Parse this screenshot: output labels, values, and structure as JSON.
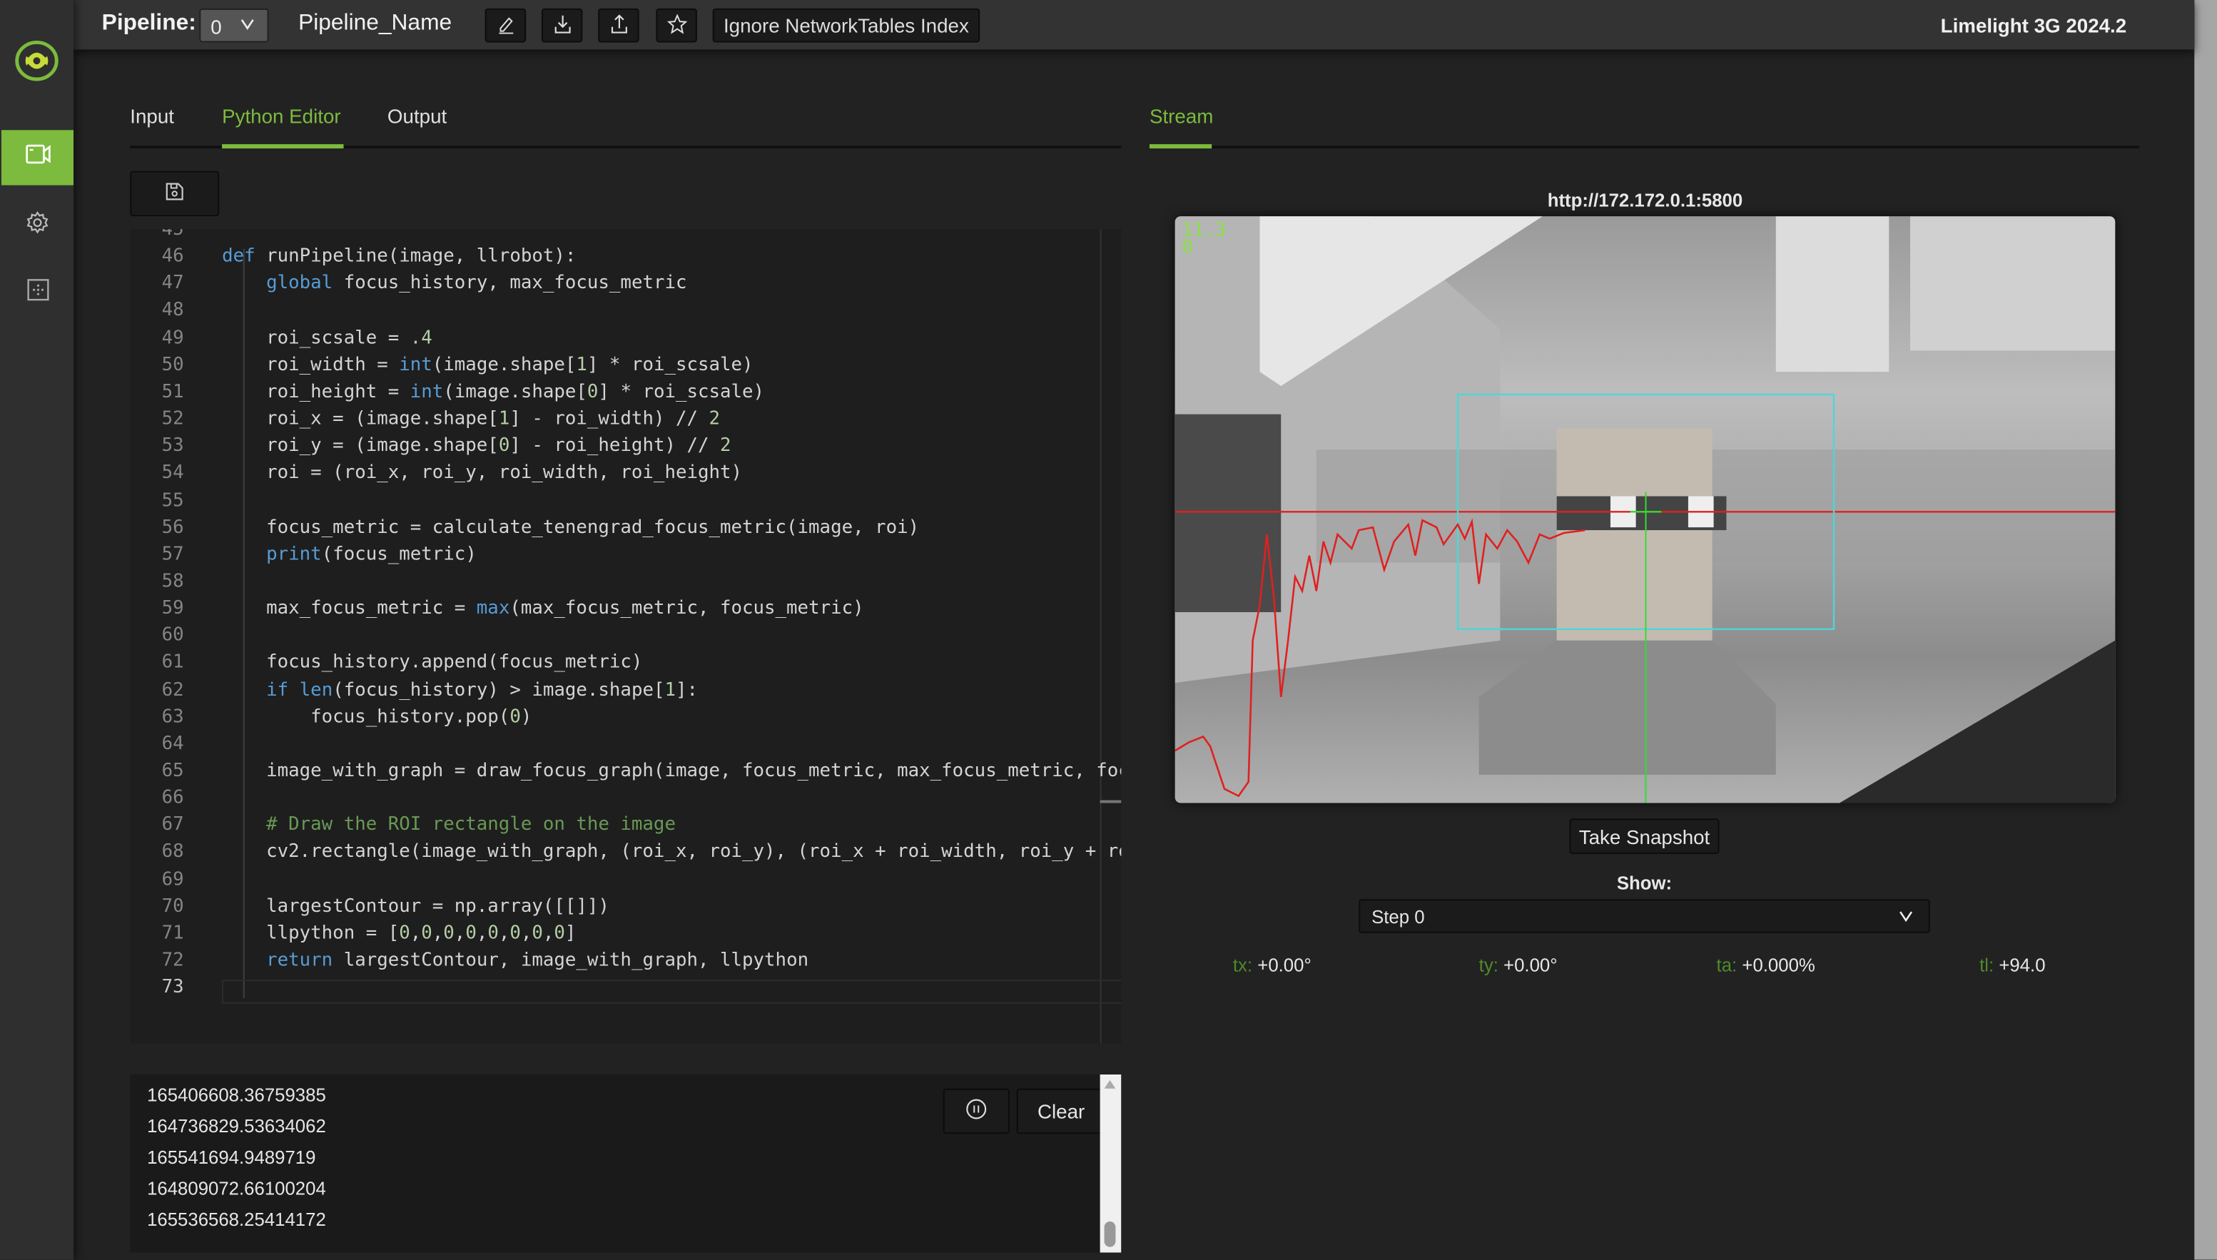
{
  "topbar": {
    "pipeline_label": "Pipeline:",
    "pipeline_index": "0",
    "pipeline_name": "Pipeline_Name",
    "edit_icon": "pencil-icon",
    "download_icon": "download-icon",
    "upload_icon": "upload-icon",
    "favorite_icon": "star-icon",
    "ignore_nt_label": "Ignore NetworkTables Index",
    "product": "Limelight 3G 2024.2"
  },
  "sidebar": {
    "items": [
      {
        "icon": "camera-icon",
        "active": true
      },
      {
        "icon": "gear-icon",
        "active": false
      },
      {
        "icon": "crosshair-grid-icon",
        "active": false
      }
    ]
  },
  "left_tabs": [
    "Input",
    "Python Editor",
    "Output"
  ],
  "active_left_tab": "Python Editor",
  "editor": {
    "save_icon": "floppy-disk-icon",
    "first_line_number": 45,
    "lines": [
      [],
      [
        [
          "def",
          "k"
        ],
        [
          " runPipeline(image, llrobot):",
          ""
        ]
      ],
      [
        [
          "    ",
          ""
        ],
        [
          "global",
          "k"
        ],
        [
          " focus_history, max_focus_metric",
          ""
        ]
      ],
      [],
      [
        [
          "    roi_scsale = ",
          ""
        ],
        [
          ".4",
          "n"
        ]
      ],
      [
        [
          "    roi_width = ",
          ""
        ],
        [
          "int",
          "k"
        ],
        [
          "(image.shape[",
          ""
        ],
        [
          "1",
          "n"
        ],
        [
          "] * roi_scsale)",
          ""
        ]
      ],
      [
        [
          "    roi_height = ",
          ""
        ],
        [
          "int",
          "k"
        ],
        [
          "(image.shape[",
          ""
        ],
        [
          "0",
          "n"
        ],
        [
          "] * roi_scsale)",
          ""
        ]
      ],
      [
        [
          "    roi_x = (image.shape[",
          ""
        ],
        [
          "1",
          "n"
        ],
        [
          "] - roi_width) // ",
          ""
        ],
        [
          "2",
          "n"
        ]
      ],
      [
        [
          "    roi_y = (image.shape[",
          ""
        ],
        [
          "0",
          "n"
        ],
        [
          "] - roi_height) // ",
          ""
        ],
        [
          "2",
          "n"
        ]
      ],
      [
        [
          "    roi = (roi_x, roi_y, roi_width, roi_height)",
          ""
        ]
      ],
      [],
      [
        [
          "    focus_metric = calculate_tenengrad_focus_metric(image, roi)",
          ""
        ]
      ],
      [
        [
          "    ",
          ""
        ],
        [
          "print",
          "k"
        ],
        [
          "(focus_metric)",
          ""
        ]
      ],
      [],
      [
        [
          "    max_focus_metric = ",
          ""
        ],
        [
          "max",
          "k"
        ],
        [
          "(max_focus_metric, focus_metric)",
          ""
        ]
      ],
      [],
      [
        [
          "    focus_history.append(focus_metric)",
          ""
        ]
      ],
      [
        [
          "    ",
          ""
        ],
        [
          "if",
          "k"
        ],
        [
          " ",
          ""
        ],
        [
          "len",
          "k"
        ],
        [
          "(focus_history) > image.shape[",
          ""
        ],
        [
          "1",
          "n"
        ],
        [
          "]:",
          ""
        ]
      ],
      [
        [
          "        focus_history.pop(",
          ""
        ],
        [
          "0",
          "n"
        ],
        [
          ")",
          ""
        ]
      ],
      [],
      [
        [
          "    image_with_graph = draw_focus_graph(image, focus_metric, max_focus_metric, foc",
          ""
        ]
      ],
      [],
      [
        [
          "    # Draw the ROI rectangle on the image",
          "c"
        ]
      ],
      [
        [
          "    cv2.rectangle(image_with_graph, (roi_x, roi_y), (roi_x + roi_width, roi_y + ro",
          ""
        ]
      ],
      [],
      [
        [
          "    largestContour = np.array([[]])",
          ""
        ]
      ],
      [
        [
          "    llpython = [",
          ""
        ],
        [
          "0",
          "n"
        ],
        [
          ",",
          ""
        ],
        [
          "0",
          "n"
        ],
        [
          ",",
          ""
        ],
        [
          "0",
          "n"
        ],
        [
          ",",
          ""
        ],
        [
          "0",
          "n"
        ],
        [
          ",",
          ""
        ],
        [
          "0",
          "n"
        ],
        [
          ",",
          ""
        ],
        [
          "0",
          "n"
        ],
        [
          ",",
          ""
        ],
        [
          "0",
          "n"
        ],
        [
          ",",
          ""
        ],
        [
          "0",
          "n"
        ],
        [
          "]",
          ""
        ]
      ],
      [
        [
          "    ",
          ""
        ],
        [
          "return",
          "k"
        ],
        [
          " largestContour, image_with_graph, llpython",
          ""
        ]
      ],
      []
    ]
  },
  "console": {
    "lines": [
      "165406608.36759385",
      "164736829.53634062",
      "165541694.9489719",
      "164809072.66100204",
      "165536568.25414172"
    ],
    "pause_icon": "pause-circle-icon",
    "clear_label": "Clear"
  },
  "stream": {
    "tab": "Stream",
    "url": "http://172.172.0.1:5800",
    "overlay_fps": "11.3",
    "overlay_count": "0",
    "snapshot_label": "Take Snapshot",
    "show_label": "Show:",
    "show_value": "Step 0",
    "readouts": [
      {
        "label": "tx:",
        "value": "+0.00°"
      },
      {
        "label": "ty:",
        "value": "+0.00°"
      },
      {
        "label": "ta:",
        "value": "+0.000%"
      },
      {
        "label": "tl:",
        "value": "+94.0"
      }
    ]
  },
  "colors": {
    "accent": "#7cbb3d",
    "roi": "#4fd6d6",
    "graph": "#e02020",
    "crosshair": "#33dd33"
  }
}
